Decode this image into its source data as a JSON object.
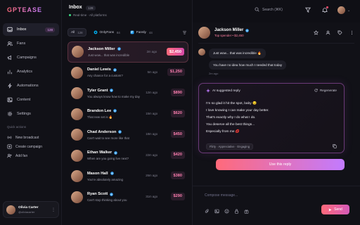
{
  "app": {
    "logo": "GPTEASE"
  },
  "sidebar": {
    "items": [
      {
        "label": "Inbox",
        "badge": "128",
        "icon": "inbox-icon",
        "active": true
      },
      {
        "label": "Fans",
        "icon": "users-icon"
      },
      {
        "label": "Campaigns",
        "icon": "megaphone-icon"
      },
      {
        "label": "Analytics",
        "icon": "bar-chart-icon"
      },
      {
        "label": "Automations",
        "icon": "lightning-icon"
      },
      {
        "label": "Content",
        "icon": "image-icon"
      },
      {
        "label": "Settings",
        "icon": "gear-icon"
      }
    ],
    "quick_actions_title": "Quick actions",
    "quick_actions": [
      {
        "label": "New broadcast",
        "icon": "broadcast-icon"
      },
      {
        "label": "Create campaign",
        "icon": "plus-square-icon"
      },
      {
        "label": "Add fan",
        "icon": "user-plus-icon"
      }
    ],
    "profile": {
      "name": "Olivia Carter",
      "handle": "@oliviacarter",
      "more": "⋮"
    }
  },
  "inbox": {
    "title": "Inbox",
    "count": "128",
    "subtitle": "Real-time · All platforms",
    "filters": [
      {
        "label": "All",
        "count": "128",
        "active": true
      },
      {
        "label": "OnlyFans",
        "count": "84",
        "icon": "onlyfans-icon"
      },
      {
        "label": "Fansly",
        "count": "44",
        "icon": "fansly-icon"
      }
    ],
    "conversations": [
      {
        "name": "Jackson Miller",
        "preview": "Just wow... that was incredible",
        "time": "2m ago",
        "amount": "$2,450",
        "selected": true
      },
      {
        "name": "Daniel Lewis",
        "preview": "Any chance for a custom?",
        "time": "5m ago",
        "amount": "$1,250"
      },
      {
        "name": "Tyler Grant",
        "preview": "You always know how to make my day",
        "time": "12m ago",
        "amount": "$890"
      },
      {
        "name": "Brandon Lee",
        "preview": "That new set is 🔥",
        "time": "15m ago",
        "amount": "$620"
      },
      {
        "name": "Chad Anderson",
        "preview": "Can't wait to see more like that",
        "time": "18m ago",
        "amount": "$450"
      },
      {
        "name": "Ethan Walker",
        "preview": "When are you going live next?",
        "time": "22m ago",
        "amount": "$420"
      },
      {
        "name": "Mason Hall",
        "preview": "You're absolutely amazing",
        "time": "26m ago",
        "amount": "$380"
      },
      {
        "name": "Ryan Scott",
        "preview": "Can't stop thinking about you",
        "time": "31m ago",
        "amount": "$290"
      }
    ]
  },
  "topbar": {
    "search_placeholder": "Search (⌘K)"
  },
  "chat": {
    "name": "Jackson Miller",
    "tag": "Top spender • $2,450",
    "messages": [
      "Just wow... that was incredible 🔥",
      "You have no idea how much I needed that today"
    ],
    "message_time": "2m ago",
    "ai": {
      "title": "AI suggested reply",
      "regenerate": "Regenerate",
      "lines": [
        "I'm so glad it hit the spot, baby 😏",
        "I love knowing I can make your day better.",
        "That's exactly why I do what I do.",
        "You deserve all the best things...",
        "Especially from me 💋"
      ],
      "tags": "Flirty · Appreciative · Engaging",
      "use_label": "Use this reply"
    },
    "composer": {
      "placeholder": "Compose message...",
      "send_label": "Send"
    }
  },
  "colors": {
    "accent_start": "#ff6a7a",
    "accent_end": "#c27bff",
    "amount_pink": "#ff7fb0",
    "verified_blue": "#3fa9ff"
  }
}
